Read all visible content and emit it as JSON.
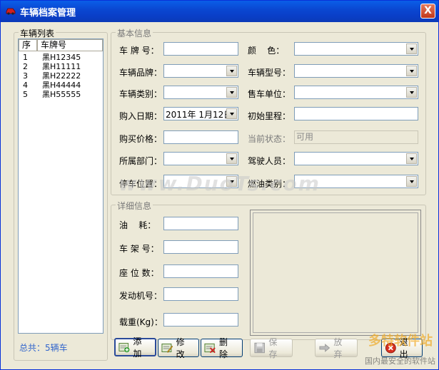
{
  "window": {
    "title": "车辆档案管理",
    "close_glyph": "X"
  },
  "sidebar": {
    "group_title": "车辆列表",
    "columns": [
      "序",
      "车牌号"
    ],
    "rows": [
      {
        "num": "1",
        "plate": "黑H12345"
      },
      {
        "num": "2",
        "plate": "黑H11111"
      },
      {
        "num": "3",
        "plate": "黑H22222"
      },
      {
        "num": "4",
        "plate": "黑H44444"
      },
      {
        "num": "5",
        "plate": "黑H55555"
      }
    ],
    "total": "总共：5辆车"
  },
  "basic": {
    "group_title": "基本信息",
    "plate_label": "车 牌 号：",
    "color_label": "颜    色：",
    "brand_label": "车辆品牌：",
    "model_label": "车辆型号：",
    "category_label": "车辆类别：",
    "dealer_label": "售车单位：",
    "purchase_date_label": "购入日期：",
    "purchase_date_value": "2011年 1月12日",
    "mileage_label": "初始里程：",
    "price_label": "购买价格：",
    "status_label": "当前状态：",
    "status_value": "可用",
    "dept_label": "所属部门：",
    "driver_label": "驾驶人员：",
    "parking_label": "停车位置：",
    "fuel_label": "燃油类别："
  },
  "detail": {
    "group_title": "详细信息",
    "fuel_consumption_label": "油    耗：",
    "frame_label": "车 架 号：",
    "seats_label": "座 位 数：",
    "engine_label": "发动机号：",
    "load_label": "载重(Kg)："
  },
  "toolbar": {
    "add": "添 加",
    "edit": "修 改",
    "delete": "删 除",
    "save": "保 存",
    "cancel": "放 弃",
    "exit": "退 出"
  },
  "watermark": {
    "text": "www.DuoTs.com",
    "brand": "多特软件站",
    "brand_sub": "国内最安全的软件站"
  }
}
